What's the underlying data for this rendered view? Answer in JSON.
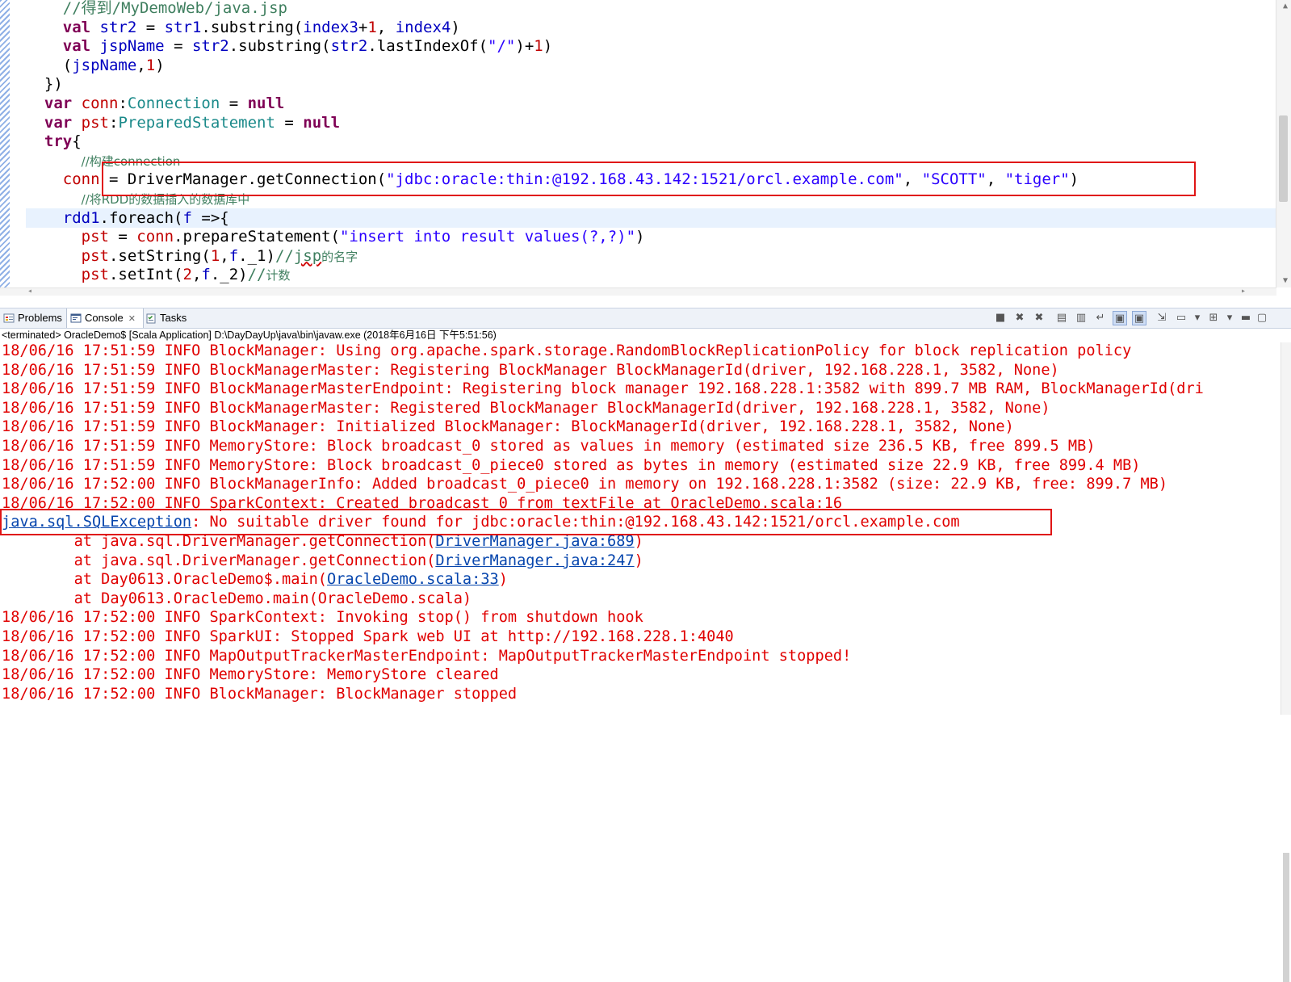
{
  "editor": {
    "lines": [
      {
        "segments": [
          {
            "t": "    "
          },
          {
            "t": "//得到/MyDemoWeb/java.jsp",
            "c": "cm"
          }
        ]
      },
      {
        "segments": [
          {
            "t": "    "
          },
          {
            "t": "val",
            "c": "kw"
          },
          {
            "t": " "
          },
          {
            "t": "str2",
            "c": "var"
          },
          {
            "t": " = "
          },
          {
            "t": "str1",
            "c": "var"
          },
          {
            "t": ".substring("
          },
          {
            "t": "index3",
            "c": "var"
          },
          {
            "t": "+"
          },
          {
            "t": "1",
            "c": "num"
          },
          {
            "t": ", "
          },
          {
            "t": "index4",
            "c": "var"
          },
          {
            "t": ")"
          }
        ]
      },
      {
        "segments": [
          {
            "t": "    "
          },
          {
            "t": "val",
            "c": "kw"
          },
          {
            "t": " "
          },
          {
            "t": "jspName",
            "c": "var"
          },
          {
            "t": " = "
          },
          {
            "t": "str2",
            "c": "var"
          },
          {
            "t": ".substring("
          },
          {
            "t": "str2",
            "c": "var"
          },
          {
            "t": ".lastIndexOf("
          },
          {
            "t": "\"/\"",
            "c": "str"
          },
          {
            "t": ")+"
          },
          {
            "t": "1",
            "c": "num"
          },
          {
            "t": ")"
          }
        ]
      },
      {
        "segments": [
          {
            "t": "    ("
          },
          {
            "t": "jspName",
            "c": "var"
          },
          {
            "t": ","
          },
          {
            "t": "1",
            "c": "num"
          },
          {
            "t": ")"
          }
        ]
      },
      {
        "segments": [
          {
            "t": "  })"
          }
        ]
      },
      {
        "segments": [
          {
            "t": "  "
          },
          {
            "t": "var",
            "c": "kw"
          },
          {
            "t": " "
          },
          {
            "t": "conn",
            "c": "num"
          },
          {
            "t": ":"
          },
          {
            "t": "Connection",
            "c": "tp"
          },
          {
            "t": " = "
          },
          {
            "t": "null",
            "c": "kw"
          }
        ]
      },
      {
        "segments": [
          {
            "t": "  "
          },
          {
            "t": "var",
            "c": "kw"
          },
          {
            "t": " "
          },
          {
            "t": "pst",
            "c": "num"
          },
          {
            "t": ":"
          },
          {
            "t": "PreparedStatement",
            "c": "tp"
          },
          {
            "t": " = "
          },
          {
            "t": "null",
            "c": "kw"
          }
        ]
      },
      {
        "segments": [
          {
            "t": "  "
          },
          {
            "t": "try",
            "c": "kw"
          },
          {
            "t": "{"
          }
        ]
      },
      {
        "segments": [
          {
            "t": "      "
          },
          {
            "t": "//构建connection",
            "c": "cmz"
          }
        ]
      },
      {
        "segments": [
          {
            "t": "    "
          },
          {
            "t": "conn",
            "c": "num"
          },
          {
            "t": " = DriverManager.getConnection("
          },
          {
            "t": "\"jdbc:oracle:thin:@192.168.43.142:1521/orcl.example.com\"",
            "c": "str"
          },
          {
            "t": ", "
          },
          {
            "t": "\"SCOTT\"",
            "c": "str"
          },
          {
            "t": ", "
          },
          {
            "t": "\"tiger\"",
            "c": "str"
          },
          {
            "t": ")"
          }
        ]
      },
      {
        "segments": [
          {
            "t": "      "
          },
          {
            "t": "//将RDD的数据插入的数据库中",
            "c": "cmz"
          }
        ]
      },
      {
        "current": true,
        "segments": [
          {
            "t": "    "
          },
          {
            "t": "rdd1",
            "c": "var"
          },
          {
            "t": ".foreach("
          },
          {
            "t": "f",
            "c": "var"
          },
          {
            "t": " =>{"
          }
        ]
      },
      {
        "segments": [
          {
            "t": "      "
          },
          {
            "t": "pst",
            "c": "num"
          },
          {
            "t": " = "
          },
          {
            "t": "conn",
            "c": "num"
          },
          {
            "t": ".prepareStatement("
          },
          {
            "t": "\"insert into result values(?,?)\"",
            "c": "str"
          },
          {
            "t": ")"
          }
        ]
      },
      {
        "segments": [
          {
            "t": "      "
          },
          {
            "t": "pst",
            "c": "num"
          },
          {
            "t": ".setString("
          },
          {
            "t": "1",
            "c": "num"
          },
          {
            "t": ","
          },
          {
            "t": "f",
            "c": "var"
          },
          {
            "t": "._1)"
          },
          {
            "t": "//",
            "c": "cm"
          },
          {
            "t": "jsp",
            "c": "cm sq"
          },
          {
            "t": "的名字",
            "c": "cmz"
          }
        ]
      },
      {
        "segments": [
          {
            "t": "      "
          },
          {
            "t": "pst",
            "c": "num"
          },
          {
            "t": ".setInt("
          },
          {
            "t": "2",
            "c": "num"
          },
          {
            "t": ","
          },
          {
            "t": "f",
            "c": "var"
          },
          {
            "t": "._2)"
          },
          {
            "t": "//",
            "c": "cm"
          },
          {
            "t": "计数",
            "c": "cmz"
          }
        ]
      }
    ]
  },
  "tabs": [
    {
      "label": "Problems",
      "icon": "problems-icon",
      "active": false
    },
    {
      "label": "Console",
      "icon": "console-icon",
      "active": true,
      "close": "✕"
    },
    {
      "label": "Tasks",
      "icon": "tasks-icon",
      "active": false
    }
  ],
  "toolbar": [
    {
      "icon": "terminate-icon",
      "glyph": "■"
    },
    {
      "icon": "remove-launch-icon",
      "glyph": "✖"
    },
    {
      "icon": "remove-all-terminated-icon",
      "glyph": "✖"
    },
    {
      "icon": "clear-console-icon",
      "glyph": "▤"
    },
    {
      "icon": "scroll-lock-icon",
      "glyph": "▥"
    },
    {
      "icon": "word-wrap-icon",
      "glyph": "↵"
    },
    {
      "icon": "show-on-stdout-icon",
      "glyph": "▣",
      "pressed": true
    },
    {
      "icon": "show-on-stderr-icon",
      "glyph": "▣",
      "pressed": true
    },
    {
      "icon": "pin-console-icon",
      "glyph": "⇲"
    },
    {
      "icon": "display-console-icon",
      "glyph": "▭"
    },
    {
      "icon": "display-console-menu-icon",
      "glyph": "▾"
    },
    {
      "icon": "open-console-icon",
      "glyph": "⊞"
    },
    {
      "icon": "open-console-menu-icon",
      "glyph": "▾"
    },
    {
      "icon": "minimize-icon",
      "glyph": "▬"
    },
    {
      "icon": "maximize-icon",
      "glyph": "▢"
    }
  ],
  "colors": {
    "error_text": "#e00000",
    "link": "#0645ad",
    "highlight_box": "#e01515",
    "current_line": "#e8f2fe"
  },
  "console": {
    "header": "<terminated> OracleDemo$ [Scala Application] D:\\DayDayUp\\java\\bin\\javaw.exe (2018年6月16日 下午5:51:56)",
    "lines": [
      {
        "segments": [
          {
            "t": "18/06/16 17:51:59 INFO BlockManager: Using org.apache.spark.storage.RandomBlockReplicationPolicy for block replication policy"
          }
        ]
      },
      {
        "segments": [
          {
            "t": "18/06/16 17:51:59 INFO BlockManagerMaster: Registering BlockManager BlockManagerId(driver, 192.168.228.1, 3582, None)"
          }
        ]
      },
      {
        "segments": [
          {
            "t": "18/06/16 17:51:59 INFO BlockManagerMasterEndpoint: Registering block manager 192.168.228.1:3582 with 899.7 MB RAM, BlockManagerId(dri"
          }
        ]
      },
      {
        "segments": [
          {
            "t": "18/06/16 17:51:59 INFO BlockManagerMaster: Registered BlockManager BlockManagerId(driver, 192.168.228.1, 3582, None)"
          }
        ]
      },
      {
        "segments": [
          {
            "t": "18/06/16 17:51:59 INFO BlockManager: Initialized BlockManager: BlockManagerId(driver, 192.168.228.1, 3582, None)"
          }
        ]
      },
      {
        "segments": [
          {
            "t": "18/06/16 17:51:59 INFO MemoryStore: Block broadcast_0 stored as values in memory (estimated size 236.5 KB, free 899.5 MB)"
          }
        ]
      },
      {
        "segments": [
          {
            "t": "18/06/16 17:51:59 INFO MemoryStore: Block broadcast_0_piece0 stored as bytes in memory (estimated size 22.9 KB, free 899.4 MB)"
          }
        ]
      },
      {
        "segments": [
          {
            "t": "18/06/16 17:52:00 INFO BlockManagerInfo: Added broadcast_0_piece0 in memory on 192.168.228.1:3582 (size: 22.9 KB, free: 899.7 MB)"
          }
        ]
      },
      {
        "segments": [
          {
            "t": "18/06/16 17:52:00 INFO SparkContext: Created broadcast 0 from textFile at OracleDemo.scala:16"
          }
        ]
      },
      {
        "segments": [
          {
            "t": "java.sql.SQLException",
            "link": true
          },
          {
            "t": ": No suitable driver found for jdbc:oracle:thin:@192.168.43.142:1521/orcl.example.com"
          }
        ]
      },
      {
        "segments": [
          {
            "t": "\tat java.sql.DriverManager.getConnection("
          },
          {
            "t": "DriverManager.java:689",
            "link": true
          },
          {
            "t": ")"
          }
        ]
      },
      {
        "segments": [
          {
            "t": "\tat java.sql.DriverManager.getConnection("
          },
          {
            "t": "DriverManager.java:247",
            "link": true
          },
          {
            "t": ")"
          }
        ]
      },
      {
        "segments": [
          {
            "t": "\tat Day0613.OracleDemo$.main("
          },
          {
            "t": "OracleDemo.scala:33",
            "link": true
          },
          {
            "t": ")"
          }
        ]
      },
      {
        "segments": [
          {
            "t": "\tat Day0613.OracleDemo.main(OracleDemo.scala)"
          }
        ]
      },
      {
        "segments": [
          {
            "t": "18/06/16 17:52:00 INFO SparkContext: Invoking stop() from shutdown hook"
          }
        ]
      },
      {
        "segments": [
          {
            "t": "18/06/16 17:52:00 INFO SparkUI: Stopped Spark web UI at http://192.168.228.1:4040"
          }
        ]
      },
      {
        "segments": [
          {
            "t": "18/06/16 17:52:00 INFO MapOutputTrackerMasterEndpoint: MapOutputTrackerMasterEndpoint stopped!"
          }
        ]
      },
      {
        "segments": [
          {
            "t": "18/06/16 17:52:00 INFO MemoryStore: MemoryStore cleared"
          }
        ]
      },
      {
        "segments": [
          {
            "t": "18/06/16 17:52:00 INFO BlockManager: BlockManager stopped"
          }
        ]
      }
    ]
  }
}
